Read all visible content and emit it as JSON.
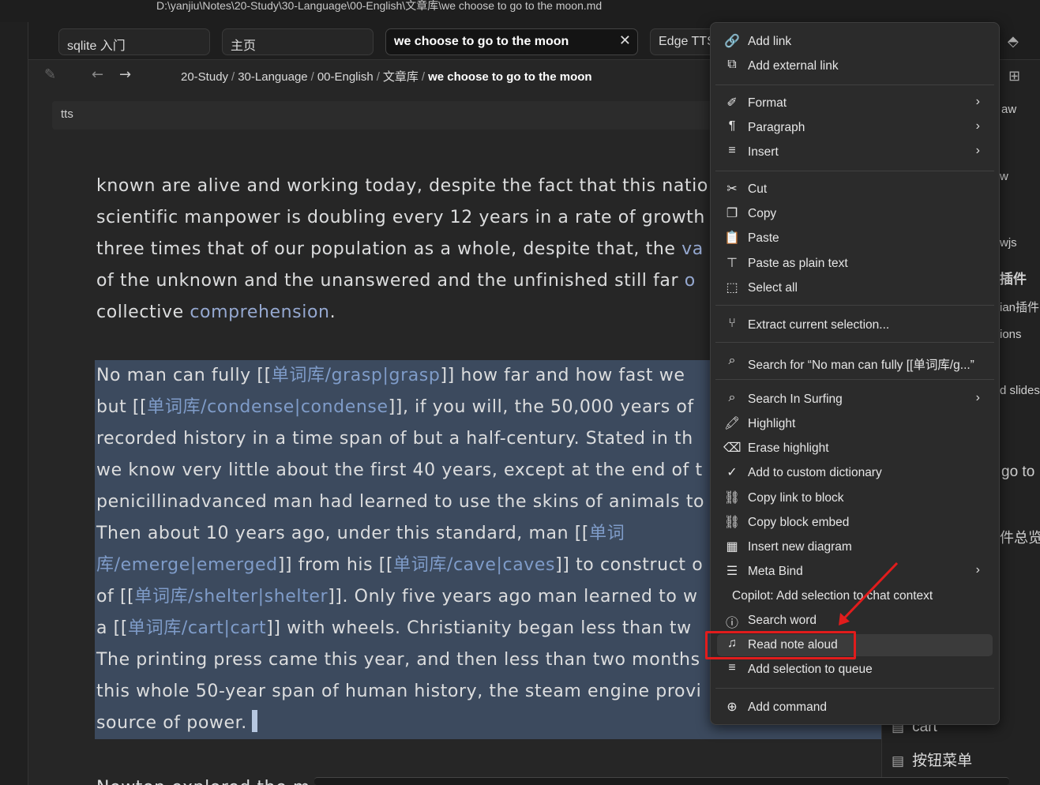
{
  "window": {
    "path": "D:\\yanjiu\\Notes\\20-Study\\30-Language\\00-English\\文章库\\we choose to go to the moon.md"
  },
  "tabs": [
    {
      "label": "sqlite 入门"
    },
    {
      "label": "主页"
    },
    {
      "label": "we choose to go to the moon",
      "active": true,
      "close": "✕"
    },
    {
      "label": "Edge TTS"
    }
  ],
  "breadcrumb": {
    "items": [
      "20-Study",
      "30-Language",
      "00-English",
      "文章库"
    ],
    "current": "we choose to go to the moon",
    "separator": "/"
  },
  "properties": {
    "value": "tts"
  },
  "editor": {
    "para1": [
      [
        "known are alive and working today, despite the fact that this natio"
      ],
      [
        "scientific manpower is doubling every 12 years in a rate of growth"
      ],
      [
        "three times that of our population as a whole, despite that, the ",
        "va"
      ],
      [
        "of the unknown and the unanswered and the unfinished still far ",
        "o"
      ],
      [
        "collective ",
        "comprehension",
        "."
      ]
    ],
    "para2": [
      [
        "No man can fully [[",
        "单词库/grasp|grasp",
        "]] how far and how fast we"
      ],
      [
        "but [[",
        "单词库/condense|condense",
        "]], if you will, the 50,000 years of"
      ],
      [
        "recorded history in a time span of but a half-century. Stated in th"
      ],
      [
        "we know very little about the first 40 years, except at the end of t"
      ],
      [
        "penicillinadvanced man had learned to use the skins of animals to"
      ],
      [
        "Then about 10 years ago, under this standard, man [[",
        "单词"
      ],
      [
        "",
        "库/emerge|emerged",
        "]] from his [[",
        "单词库/cave|caves",
        "]] to construct o"
      ],
      [
        "of [[",
        "单词库/shelter|shelter",
        "]]. Only five years ago man learned to w"
      ],
      [
        "a [[",
        "单词库/cart|cart",
        "]] with wheels. Christianity began less than tw"
      ],
      [
        "The printing press came this year, and then less than two months"
      ],
      [
        "this whole 50-year span of human history, the steam engine provi"
      ],
      [
        "source of power."
      ]
    ],
    "para3": "Newton explored the m"
  },
  "right_sidebar": {
    "fragments": [
      "aw",
      "w",
      "wjs",
      "插件",
      "ian插件",
      "ions",
      "d slides",
      "go to",
      "件总览"
    ],
    "items": [
      "cart",
      "按钮菜单"
    ]
  },
  "context_menu": {
    "items": [
      {
        "label": "Add link",
        "icon": "link-icon",
        "glyph": "🔗"
      },
      {
        "label": "Add external link",
        "icon": "external-link-icon",
        "glyph": "⧉"
      },
      {
        "label": "Format",
        "icon": "paintbrush-icon",
        "glyph": "✐",
        "submenu": true
      },
      {
        "label": "Paragraph",
        "icon": "pilcrow-icon",
        "glyph": "¶",
        "submenu": true
      },
      {
        "label": "Insert",
        "icon": "list-plus-icon",
        "glyph": "≡",
        "submenu": true
      },
      {
        "label": "Cut",
        "icon": "scissors-icon",
        "glyph": "✂"
      },
      {
        "label": "Copy",
        "icon": "copy-icon",
        "glyph": "❐"
      },
      {
        "label": "Paste",
        "icon": "clipboard-icon",
        "glyph": "📋"
      },
      {
        "label": "Paste as plain text",
        "icon": "clipboard-type-icon",
        "glyph": "⊤"
      },
      {
        "label": "Select all",
        "icon": "select-all-icon",
        "glyph": "⬚"
      },
      {
        "label": "Extract current selection...",
        "icon": "git-branch-icon",
        "glyph": "⑂"
      },
      {
        "label": "Search for “No man can fully [[单词库/g...”",
        "icon": "search-icon",
        "glyph": "⌕"
      },
      {
        "label": "Search In Surfing",
        "icon": "search-icon",
        "glyph": "⌕",
        "submenu": true
      },
      {
        "label": "Highlight",
        "icon": "highlighter-icon",
        "glyph": "🖍"
      },
      {
        "label": "Erase highlight",
        "icon": "eraser-icon",
        "glyph": "⌫"
      },
      {
        "label": "Add to custom dictionary",
        "icon": "spell-check-icon",
        "glyph": "✓"
      },
      {
        "label": "Copy link to block",
        "icon": "link-block-icon",
        "glyph": "⛓"
      },
      {
        "label": "Copy block embed",
        "icon": "embed-block-icon",
        "glyph": "⛓"
      },
      {
        "label": "Insert new diagram",
        "icon": "diagram-icon",
        "glyph": "▦"
      },
      {
        "label": "Meta Bind",
        "icon": "list-icon",
        "glyph": "☰",
        "submenu": true
      },
      {
        "label": "Copilot: Add selection to chat context"
      },
      {
        "label": "Search word",
        "icon": "info-icon",
        "glyph": "ⓘ"
      },
      {
        "label": "Read note aloud",
        "icon": "audio-waveform-icon",
        "glyph": "♫",
        "highlighted": true
      },
      {
        "label": "Add selection to queue",
        "icon": "list-end-icon",
        "glyph": "≡"
      },
      {
        "label": "Add command",
        "icon": "plus-circle-icon",
        "glyph": "⊕"
      }
    ],
    "submenu_glyph": "›"
  },
  "colors": {
    "annotation": "#e11c1c",
    "selection": "#3c4a5e",
    "link": "#7f9cc9"
  }
}
